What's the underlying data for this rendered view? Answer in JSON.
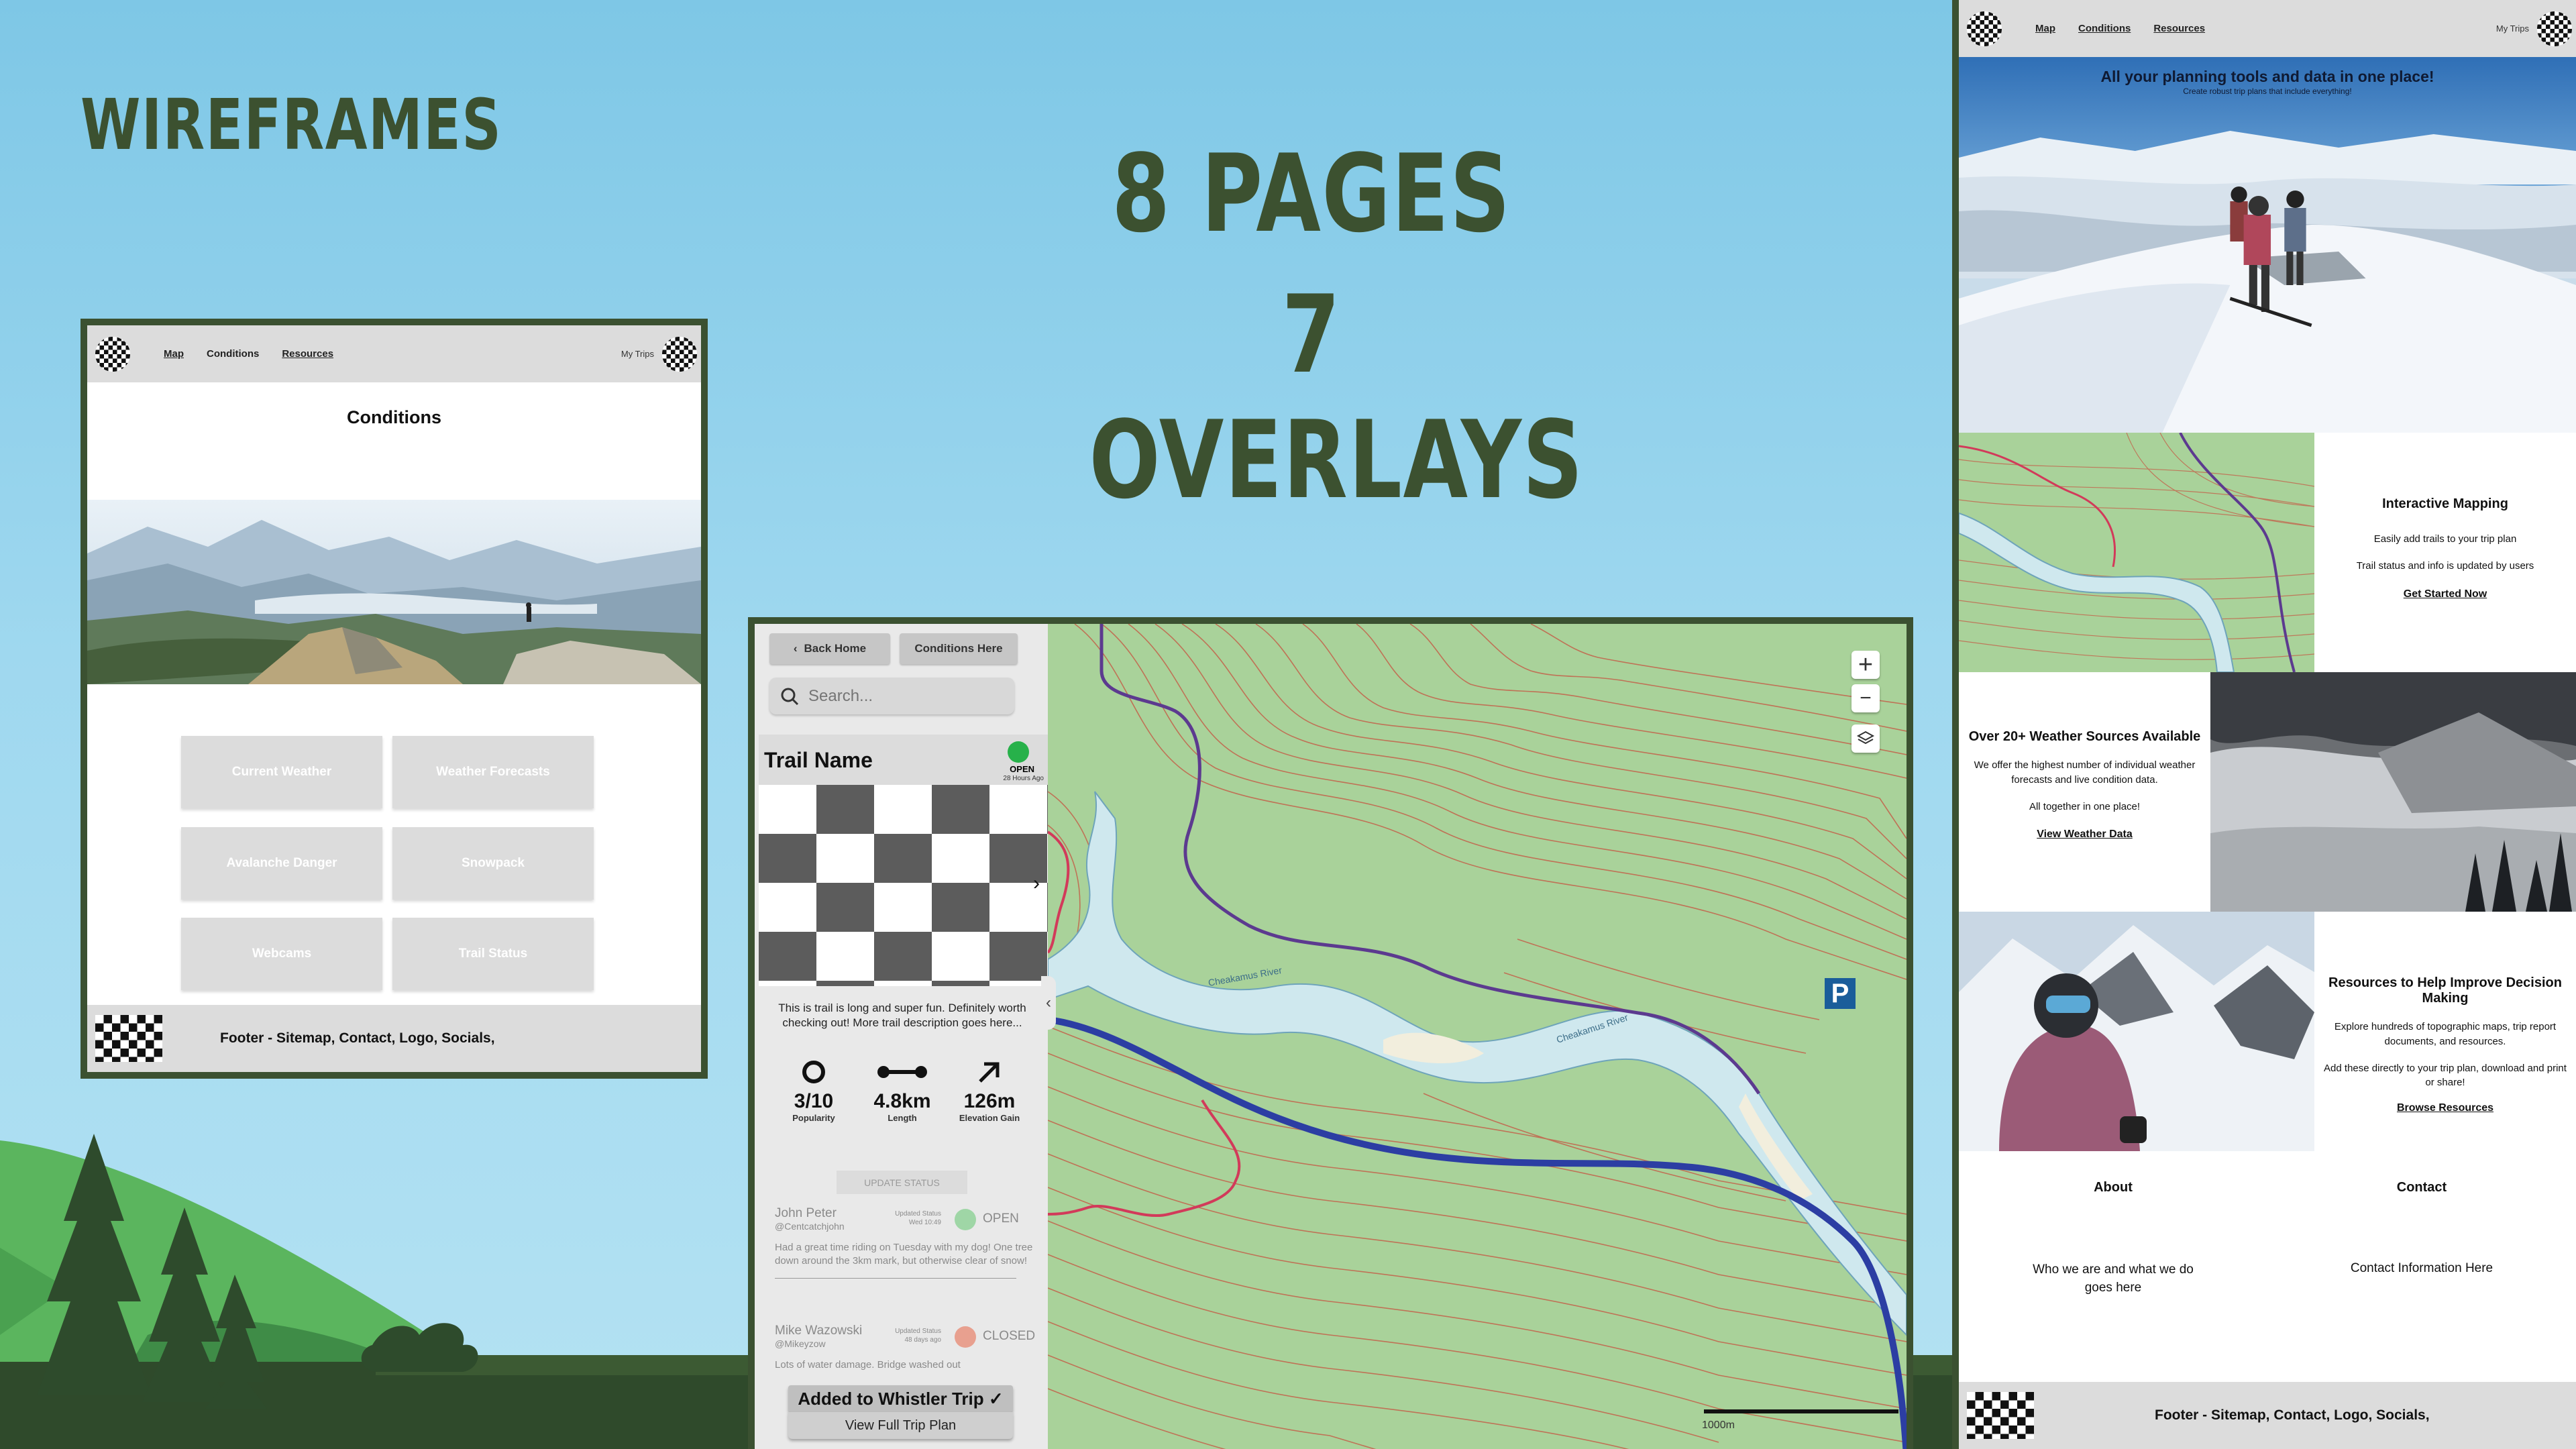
{
  "headings": {
    "title": "WIREFRAMES",
    "pages": "8 PAGES",
    "overlays": "7 OVERLAYS"
  },
  "nav": {
    "map": "Map",
    "conditions": "Conditions",
    "resources": "Resources",
    "my_trips": "My Trips"
  },
  "conditions_page": {
    "title": "Conditions",
    "buttons": [
      "Current Weather",
      "Weather Forecasts",
      "Avalanche Danger",
      "Snowpack",
      "Webcams",
      "Trail Status"
    ],
    "footer": "Footer - Sitemap, Contact, Logo, Socials,"
  },
  "map_page": {
    "back_home": "Back Home",
    "conditions_here": "Conditions Here",
    "search_placeholder": "Search...",
    "trail": {
      "name": "Trail Name",
      "status": "OPEN",
      "status_age": "28 Hours Ago",
      "description": "This is trail is long and super fun. Definitely worth checking out! More trail description goes here...",
      "stats": [
        {
          "value": "3/10",
          "label": "Popularity"
        },
        {
          "value": "4.8km",
          "label": "Length"
        },
        {
          "value": "126m",
          "label": "Elevation Gain"
        }
      ]
    },
    "update_status": "UPDATE STATUS",
    "reviews": [
      {
        "name": "John Peter",
        "handle": "@Centcatchjohn",
        "updated": "Updated Status",
        "when": "Wed 10:49",
        "status": "OPEN",
        "status_color": "#9fd6a6",
        "text": "Had a great time riding on Tuesday with my dog! One tree down around the 3km mark, but otherwise clear of snow!"
      },
      {
        "name": "Mike Wazowski",
        "handle": "@Mikeyzow",
        "updated": "Updated Status",
        "when": "48 days ago",
        "status": "CLOSED",
        "status_color": "#e8a08f",
        "text": "Lots of water damage. Bridge washed out"
      }
    ],
    "toast": "Added to Whistler Trip ✓",
    "view_plan": "View Full Trip Plan",
    "river_label_1": "Cheakamus River",
    "river_label_2": "Cheakamus River",
    "scale": "1000m"
  },
  "home_page": {
    "hero_title": "All your planning tools and data in one place!",
    "hero_subtitle": "Create robust trip plans that include everything!",
    "mapping": {
      "title": "Interactive Mapping",
      "line1": "Easily add trails to your trip plan",
      "line2": "Trail status and info is updated by users",
      "cta": "Get Started Now"
    },
    "weather": {
      "title": "Over 20+ Weather Sources Available",
      "line1": "We offer the highest number of individual weather forecasts and live condition data.",
      "line2": "All together in one place!",
      "cta": "View Weather Data"
    },
    "resources": {
      "title": "Resources to Help Improve Decision Making",
      "line1": "Explore hundreds of topographic maps, trip report documents, and resources.",
      "line2": "Add these directly to your trip plan, download and print or share!",
      "cta": "Browse Resources"
    },
    "about": {
      "title": "About",
      "text": "Who we are and what we do goes here"
    },
    "contact": {
      "title": "Contact",
      "text": "Contact Information Here"
    },
    "footer": "Footer - Sitemap, Contact, Logo, Socials,"
  }
}
